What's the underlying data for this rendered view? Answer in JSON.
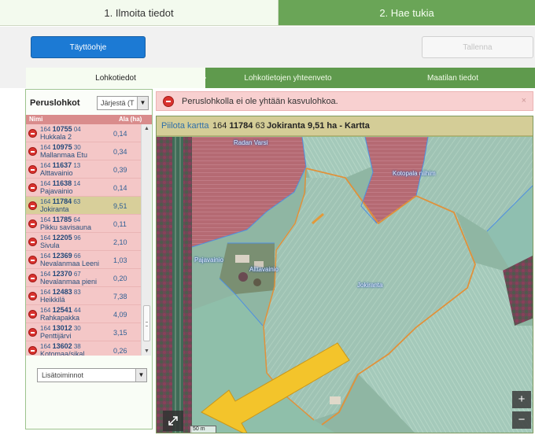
{
  "steps": {
    "step1": "1. Ilmoita tiedot",
    "step2": "2. Hae tukia"
  },
  "actions": {
    "fill_help": "Täyttöohje",
    "save": "Tallenna"
  },
  "tabs": [
    {
      "label": "Lohkotiedot",
      "active": true
    },
    {
      "label": "Lohkotietojen yhteenveto",
      "active": false
    },
    {
      "label": "Maatilan tiedot",
      "active": false
    }
  ],
  "parcel_panel": {
    "title": "Peruslohkot",
    "sort_placeholder": "Järjestä (T",
    "col_name": "Nimi",
    "col_area": "Ala (ha)",
    "rows": [
      {
        "prefix": "164",
        "num": "10755",
        "suffix": "04",
        "name": "Hukkala 2",
        "area": "0,14",
        "selected": false
      },
      {
        "prefix": "164",
        "num": "10975",
        "suffix": "30",
        "name": "Mallanmaa Etu",
        "area": "0,34",
        "selected": false
      },
      {
        "prefix": "164",
        "num": "11637",
        "suffix": "13",
        "name": "Alttavainio",
        "area": "0,39",
        "selected": false
      },
      {
        "prefix": "164",
        "num": "11638",
        "suffix": "14",
        "name": "Pajavainio",
        "area": "0,14",
        "selected": false
      },
      {
        "prefix": "164",
        "num": "11784",
        "suffix": "63",
        "name": "Jokiranta",
        "area": "9,51",
        "selected": true
      },
      {
        "prefix": "164",
        "num": "11785",
        "suffix": "64",
        "name": "Pikku savisauna",
        "area": "0,11",
        "selected": false
      },
      {
        "prefix": "164",
        "num": "12205",
        "suffix": "96",
        "name": "Sivula",
        "area": "2,10",
        "selected": false
      },
      {
        "prefix": "164",
        "num": "12369",
        "suffix": "66",
        "name": "Nevalanmaa Leeni",
        "area": "1,03",
        "selected": false
      },
      {
        "prefix": "164",
        "num": "12370",
        "suffix": "67",
        "name": "Nevalanmaa pieni",
        "area": "0,20",
        "selected": false
      },
      {
        "prefix": "164",
        "num": "12483",
        "suffix": "83",
        "name": "Heikkilä",
        "area": "7,38",
        "selected": false
      },
      {
        "prefix": "164",
        "num": "12541",
        "suffix": "44",
        "name": "Rahkapakka",
        "area": "4,09",
        "selected": false
      },
      {
        "prefix": "164",
        "num": "13012",
        "suffix": "30",
        "name": "Penttijärvi",
        "area": "3,15",
        "selected": false
      },
      {
        "prefix": "164",
        "num": "13602",
        "suffix": "38",
        "name": "Kotomaa/sikal",
        "area": "0,26",
        "selected": false
      }
    ],
    "more_actions": "Lisätoiminnot"
  },
  "alert": {
    "text": "Peruslohkolla ei ole yhtään kasvulohkoa.",
    "close": "×"
  },
  "map": {
    "hide_link": "Piilota kartta",
    "parcel_prefix": "164",
    "parcel_num": "11784",
    "parcel_suffix": "63",
    "title": "Jokiranta 9,51 ha - Kartta",
    "labels": {
      "radan_varsi": "Radan Varsi",
      "kotopala": "Kotopala niihim",
      "pajavainio": "Pajavainio",
      "alttavainio": "Alttavainio",
      "jokiranta": "Jokiranta"
    },
    "zoom_in": "+",
    "zoom_out": "−",
    "scale": "50 m"
  },
  "colors": {
    "step_active_bg": "#f3faee",
    "step_inactive_bg": "#6aa557",
    "primary_button": "#1c7ad4",
    "parcel_row": "#f4c7c7",
    "parcel_row_selected": "#d8cf9a",
    "alert_bg": "#f8d0d0",
    "map_header": "#d4cd97",
    "annotation_arrow": "#f3c42b"
  }
}
